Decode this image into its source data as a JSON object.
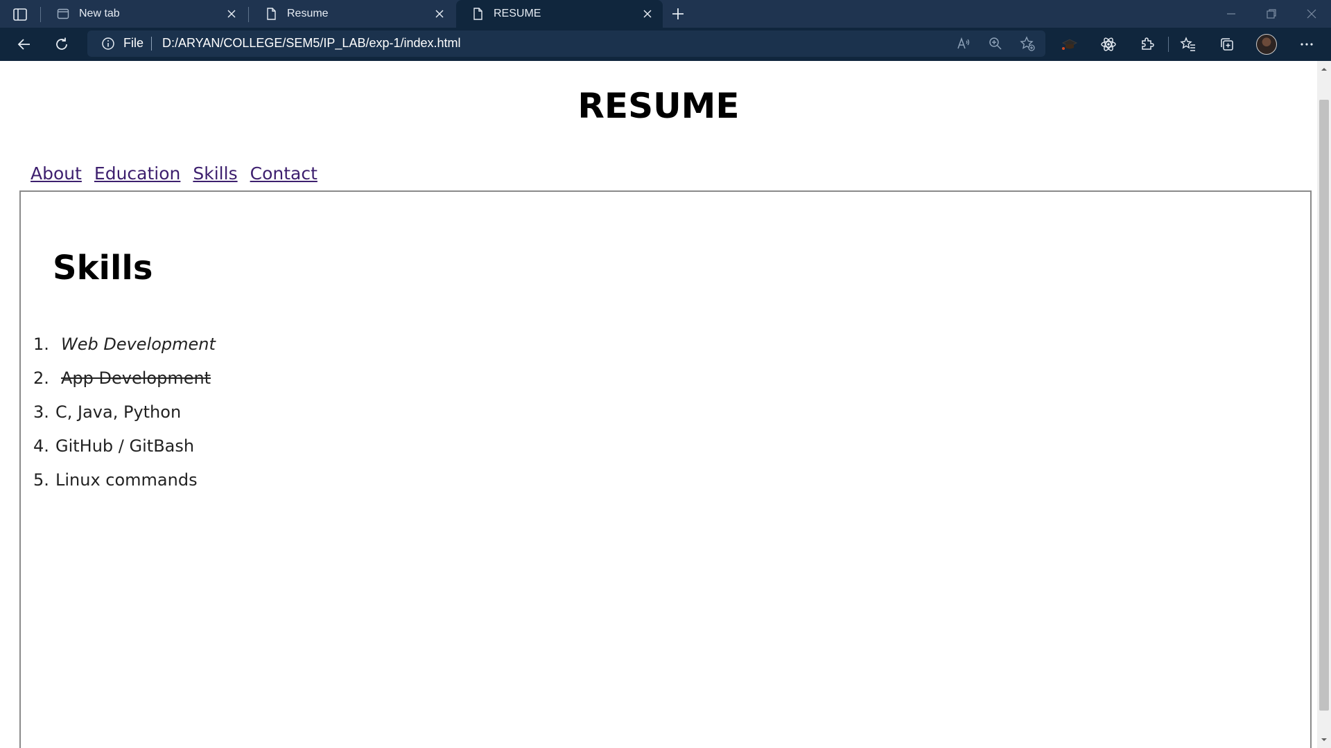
{
  "browser": {
    "tabs": [
      {
        "label": "New tab",
        "icon": "newtab-page-icon",
        "active": false
      },
      {
        "label": "Resume",
        "icon": "file-icon",
        "active": false
      },
      {
        "label": "RESUME",
        "icon": "file-icon",
        "active": true
      }
    ],
    "address": {
      "scheme_label": "File",
      "url": "D:/ARYAN/COLLEGE/SEM5/IP_LAB/exp-1/index.html"
    },
    "colors": {
      "tabbar": "#1f3450",
      "toolbar": "#10263d"
    }
  },
  "page": {
    "title": "RESUME",
    "nav": [
      "About",
      "Education",
      "Skills",
      "Contact"
    ],
    "section_title": "Skills",
    "skills": [
      {
        "number": "1.",
        "text": "Web Development",
        "style": "italic"
      },
      {
        "number": "2.",
        "text": "App Development",
        "style": "strikethrough"
      },
      {
        "number": "3.",
        "text": "C, Java, Python",
        "style": "normal"
      },
      {
        "number": "4.",
        "text": "GitHub / GitBash",
        "style": "normal"
      },
      {
        "number": "5.",
        "text": "Linux commands",
        "style": "normal"
      }
    ],
    "link_color": "#3d1f6e"
  }
}
